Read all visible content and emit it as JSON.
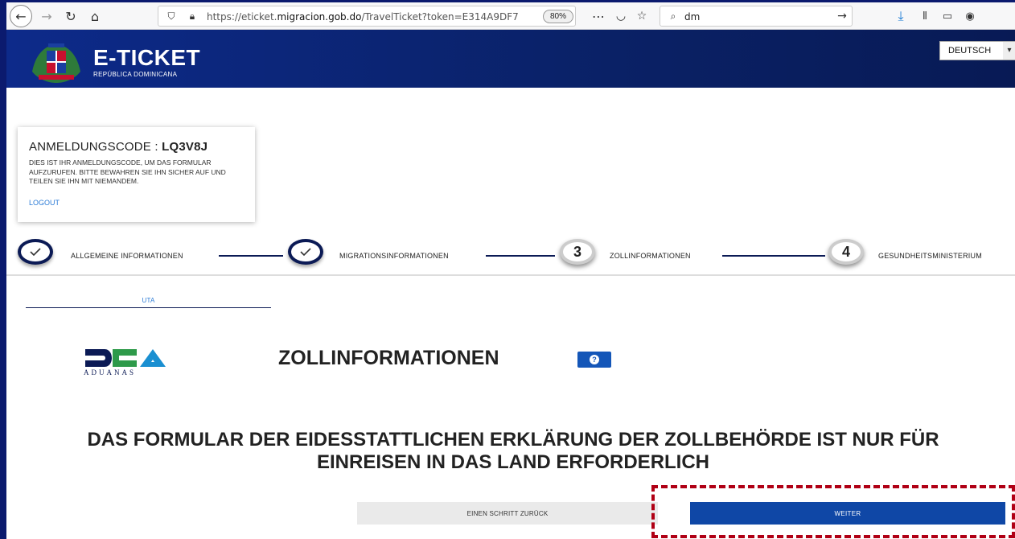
{
  "browser": {
    "url_prefix": "https://eticket.",
    "url_domain": "migracion.gob.do",
    "url_suffix": "/TravelTicket?token=E314A9DF7",
    "zoom": "80%",
    "search_value": "dm"
  },
  "header": {
    "title": "E-TICKET",
    "subtitle": "REPÚBLICA DOMINICANA",
    "language": "DEUTSCH"
  },
  "code_card": {
    "label": "ANMELDUNGSCODE : ",
    "code": "LQ3V8J",
    "description": "DIES IST IHR ANMELDUNGSCODE, UM DAS FORMULAR AUFZURUFEN. BITTE BEWAHREN SIE IHN SICHER AUF UND TEILEN SIE IHN MIT NIEMANDEM.",
    "logout": "LOGOUT"
  },
  "steps": [
    {
      "number": "",
      "label": "ALLGEMEINE INFORMATIONEN",
      "status": "done"
    },
    {
      "number": "",
      "label": "MIGRATIONSINFORMATIONEN",
      "status": "done"
    },
    {
      "number": "3",
      "label": "ZOLLINFORMATIONEN",
      "status": "current"
    },
    {
      "number": "4",
      "label": "GESUNDHEITSMINISTERIUM",
      "status": "pending"
    }
  ],
  "subtab": "UTA",
  "logo": {
    "acronym": "DGA",
    "name": "ADUANAS"
  },
  "section_title": "ZOLLINFORMATIONEN",
  "notice": "DAS FORMULAR DER EIDESSTATTLICHEN ERKLÄRUNG DER ZOLLBEHÖRDE IST NUR FÜR EINREISEN IN DAS LAND ERFORDERLICH",
  "buttons": {
    "back": "EINEN SCHRITT ZURÜCK",
    "next": "WEITER"
  },
  "colors": {
    "navy": "#0b1a55",
    "primary_button": "#0f47a6",
    "highlight": "#b00015",
    "link": "#2d7cd6"
  }
}
